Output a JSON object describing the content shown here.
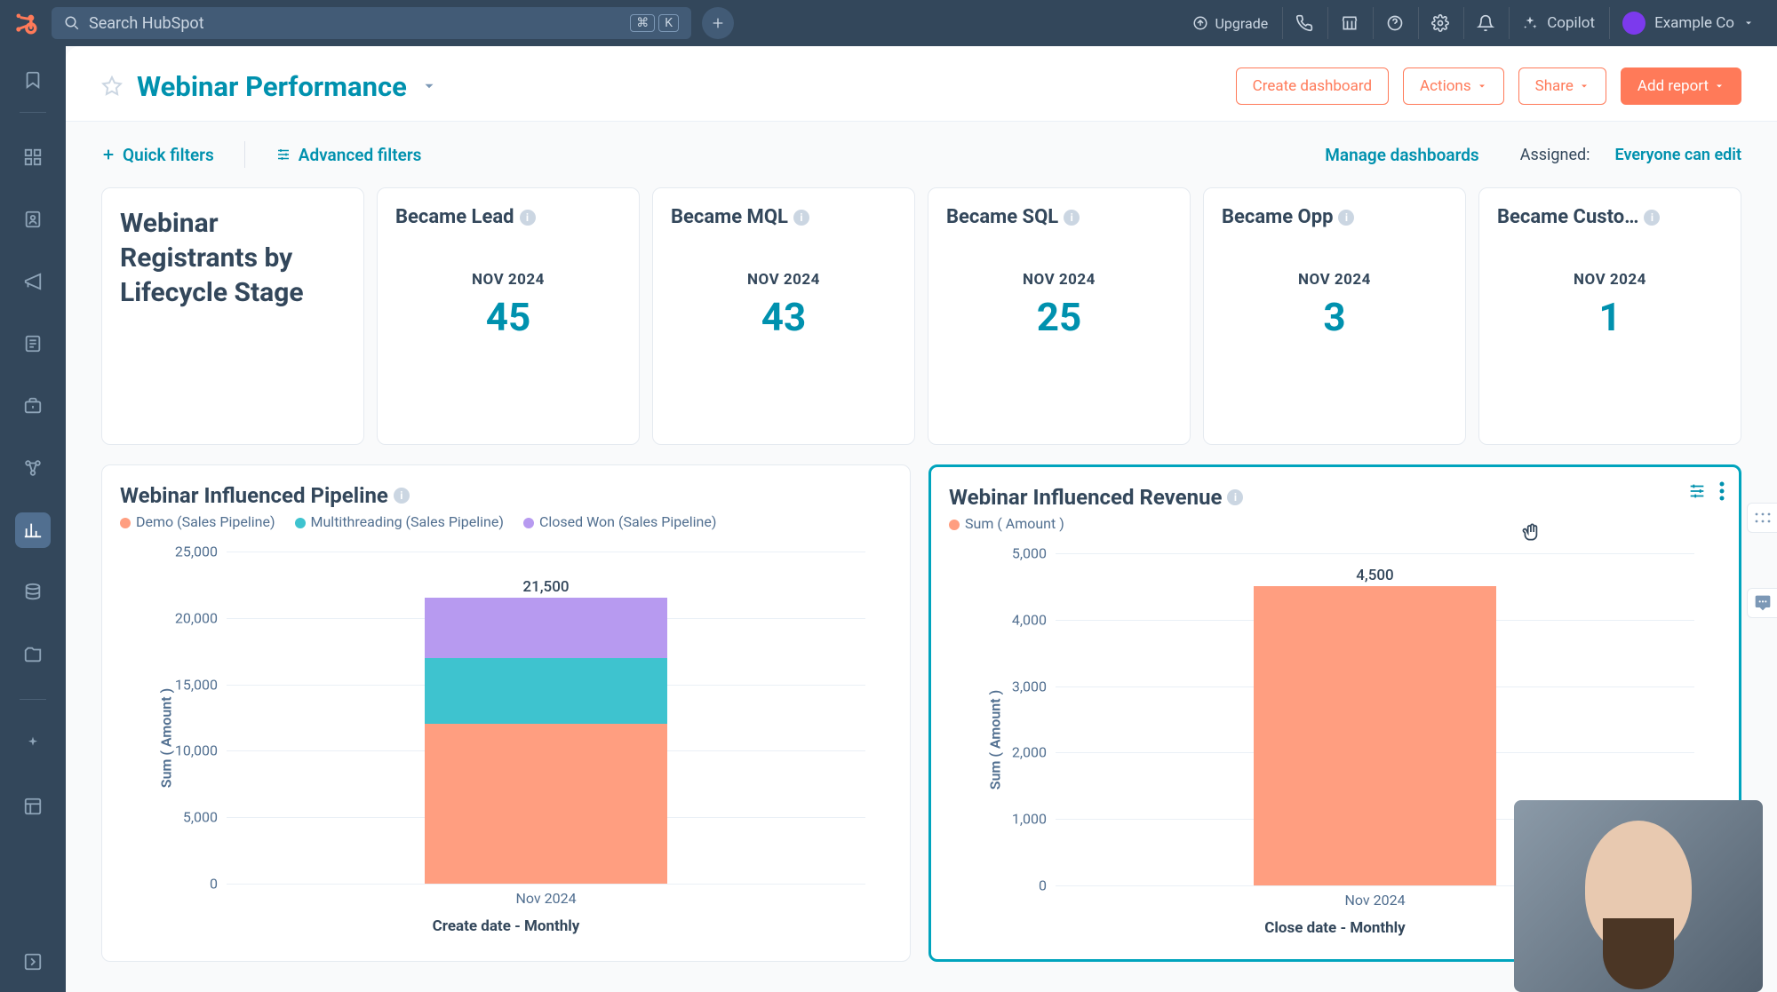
{
  "topnav": {
    "search_placeholder": "Search HubSpot",
    "kbd1": "⌘",
    "kbd2": "K",
    "upgrade": "Upgrade",
    "copilot": "Copilot",
    "account": "Example Co"
  },
  "page": {
    "title": "Webinar Performance",
    "create_dashboard": "Create dashboard",
    "actions": "Actions",
    "share": "Share",
    "add_report": "Add report"
  },
  "filters": {
    "quick": "Quick filters",
    "advanced": "Advanced filters",
    "manage": "Manage dashboards",
    "assigned_label": "Assigned:",
    "assigned_value": "Everyone can edit"
  },
  "cards": {
    "header": "Webinar Registrants by Lifecycle Stage",
    "items": [
      {
        "title": "Became Lead",
        "period": "NOV 2024",
        "value": "45"
      },
      {
        "title": "Became MQL",
        "period": "NOV 2024",
        "value": "43"
      },
      {
        "title": "Became SQL",
        "period": "NOV 2024",
        "value": "25"
      },
      {
        "title": "Became Opp",
        "period": "NOV 2024",
        "value": "3"
      },
      {
        "title": "Became Custo…",
        "period": "NOV 2024",
        "value": "1"
      }
    ]
  },
  "chart_data": [
    {
      "type": "bar",
      "title": "Webinar Influenced Pipeline",
      "ylabel": "Sum ( Amount )",
      "xlabel": "Create date - Monthly",
      "categories": [
        "Nov 2024"
      ],
      "ylim": [
        0,
        25000
      ],
      "yticks": [
        0,
        5000,
        10000,
        15000,
        20000,
        25000
      ],
      "total_label": "21,500",
      "series": [
        {
          "name": "Demo (Sales Pipeline)",
          "color": "#ff9e80",
          "values": [
            12000
          ]
        },
        {
          "name": "Multithreading (Sales Pipeline)",
          "color": "#3ec3cf",
          "values": [
            5000
          ]
        },
        {
          "name": "Closed Won (Sales Pipeline)",
          "color": "#b79af0",
          "values": [
            4500
          ]
        }
      ]
    },
    {
      "type": "bar",
      "title": "Webinar Influenced Revenue",
      "ylabel": "Sum ( Amount )",
      "xlabel": "Close date - Monthly",
      "categories": [
        "Nov 2024"
      ],
      "ylim": [
        0,
        5000
      ],
      "yticks": [
        0,
        1000,
        2000,
        3000,
        4000,
        5000
      ],
      "total_label": "4,500",
      "series": [
        {
          "name": "Sum ( Amount )",
          "color": "#ff9e80",
          "values": [
            4500
          ]
        }
      ]
    }
  ]
}
